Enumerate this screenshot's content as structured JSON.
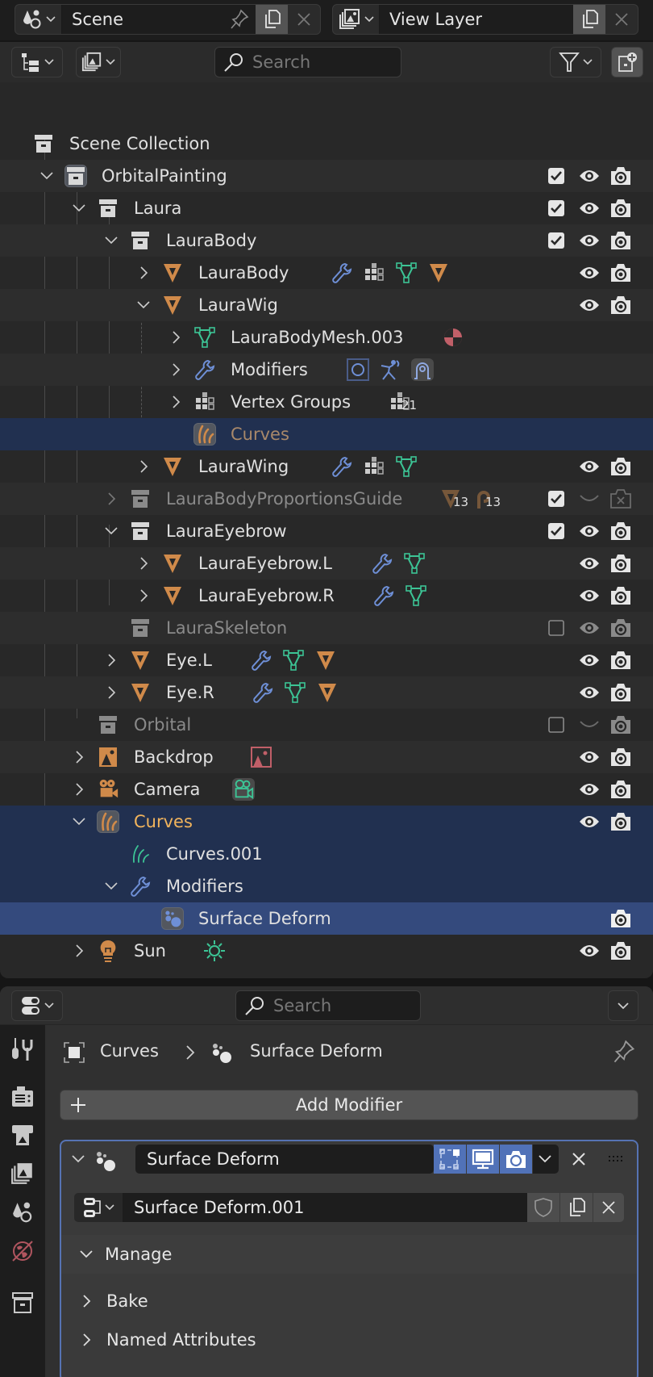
{
  "topbar": {
    "scene_name": "Scene",
    "view_layer_name": "View Layer"
  },
  "outliner": {
    "search_placeholder": "Search",
    "rows": [
      {
        "label": "Scene Collection"
      },
      {
        "label": "OrbitalPainting"
      },
      {
        "label": "Laura"
      },
      {
        "label": "LauraBody"
      },
      {
        "label": "LauraBody"
      },
      {
        "label": "LauraWig"
      },
      {
        "label": "LauraBodyMesh.003"
      },
      {
        "label": "Modifiers"
      },
      {
        "label": "Vertex Groups",
        "badge": "21"
      },
      {
        "label": "Curves"
      },
      {
        "label": "LauraWing"
      },
      {
        "label": "LauraBodyProportionsGuide",
        "badge_objects": "13",
        "badge_armatures": "13"
      },
      {
        "label": "LauraEyebrow"
      },
      {
        "label": "LauraEyebrow.L"
      },
      {
        "label": "LauraEyebrow.R"
      },
      {
        "label": "LauraSkeleton"
      },
      {
        "label": "Eye.L"
      },
      {
        "label": "Eye.R"
      },
      {
        "label": "Orbital"
      },
      {
        "label": "Backdrop"
      },
      {
        "label": "Camera"
      },
      {
        "label": "Curves"
      },
      {
        "label": "Curves.001"
      },
      {
        "label": "Modifiers"
      },
      {
        "label": "Surface Deform"
      },
      {
        "label": "Sun"
      }
    ]
  },
  "properties": {
    "search_placeholder": "Search",
    "breadcrumb": {
      "object": "Curves",
      "modifier": "Surface Deform"
    },
    "add_modifier_label": "Add Modifier",
    "modifier": {
      "name": "Surface Deform",
      "node_group": "Surface Deform.001",
      "show_edit_mode": true,
      "show_viewport": true,
      "show_render": true,
      "panels": [
        {
          "label": "Manage",
          "expanded": true
        },
        {
          "label": "Bake",
          "expanded": false
        },
        {
          "label": "Named Attributes",
          "expanded": false
        }
      ]
    }
  },
  "colors": {
    "accent_blue": "#5172b8",
    "selection": "#213050",
    "active": "#344a7d",
    "object_orange": "#d08a4a",
    "mesh_green": "#3cc495",
    "modifier_blue": "#6e8fd6",
    "active_text": "#f2b45c"
  }
}
